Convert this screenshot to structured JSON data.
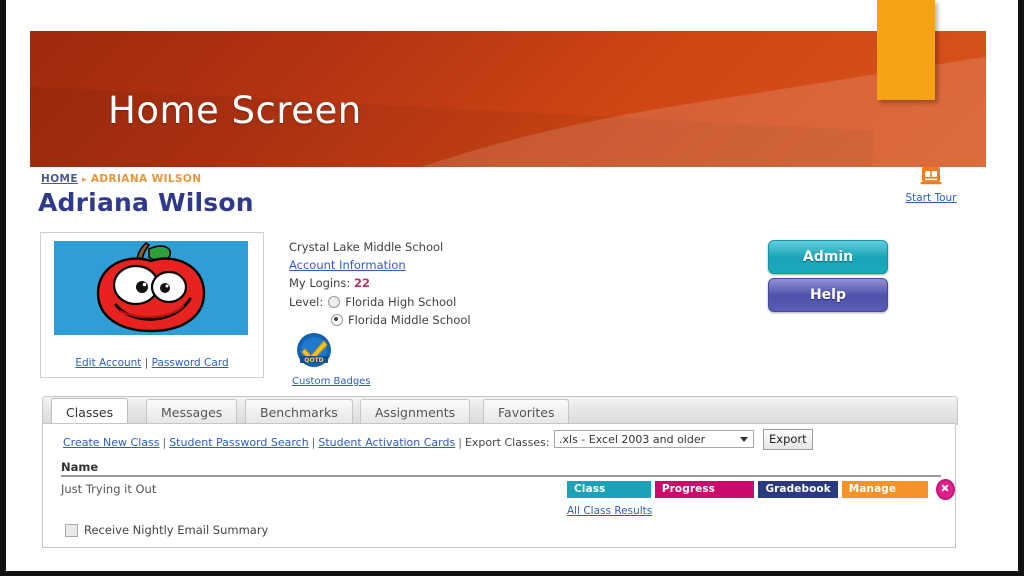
{
  "slide": {
    "banner_title": "Home Screen",
    "accent_color": "#F5A217",
    "banner_color": "#b23312"
  },
  "breadcrumb": {
    "home": "HOME",
    "separator": "▸",
    "current": "ADRIANA WILSON"
  },
  "page_title": "Adriana Wilson",
  "start_tour": {
    "icon": "bus-icon",
    "label": "Start Tour"
  },
  "avatar": {
    "image_alt": "apple-avatar",
    "edit_account": "Edit Account",
    "divider": "|",
    "password_card": "Password Card"
  },
  "info": {
    "school": "Crystal Lake Middle School",
    "account_information": "Account Information",
    "logins_label": "My Logins:",
    "logins_count": "22",
    "level_label": "Level:",
    "level_options": [
      {
        "label": "Florida High School",
        "selected": false
      },
      {
        "label": "Florida Middle School",
        "selected": true
      }
    ],
    "badge_text": "QOTD",
    "custom_badges": "Custom Badges"
  },
  "actions": {
    "admin": "Admin",
    "help": "Help"
  },
  "tabs": [
    {
      "label": "Classes",
      "active": true
    },
    {
      "label": "Messages",
      "active": false
    },
    {
      "label": "Benchmarks",
      "active": false
    },
    {
      "label": "Assignments",
      "active": false
    },
    {
      "label": "Favorites",
      "active": false
    }
  ],
  "toolbar": {
    "create_new_class": "Create New Class",
    "student_password_search": "Student Password Search",
    "student_activation_cards": "Student Activation Cards",
    "export_label": "Export Classes:",
    "export_value": ".xls - Excel 2003 and older",
    "export_button": "Export",
    "pipe": "|"
  },
  "table": {
    "header": "Name",
    "rows": [
      {
        "name": "Just Trying it Out",
        "buttons": [
          {
            "label": "Class Results",
            "color": "#1aa3b8"
          },
          {
            "label": "Progress Report",
            "color": "#cc0a6c"
          },
          {
            "label": "Gradebook",
            "color": "#2b3a7e"
          },
          {
            "label": "Manage Class",
            "color": "#f59426"
          }
        ],
        "delete_icon": "delete-circle-icon"
      }
    ],
    "all_class_results": "All Class Results"
  },
  "nightly_email": {
    "label": "Receive Nightly Email Summary",
    "checked": false
  }
}
